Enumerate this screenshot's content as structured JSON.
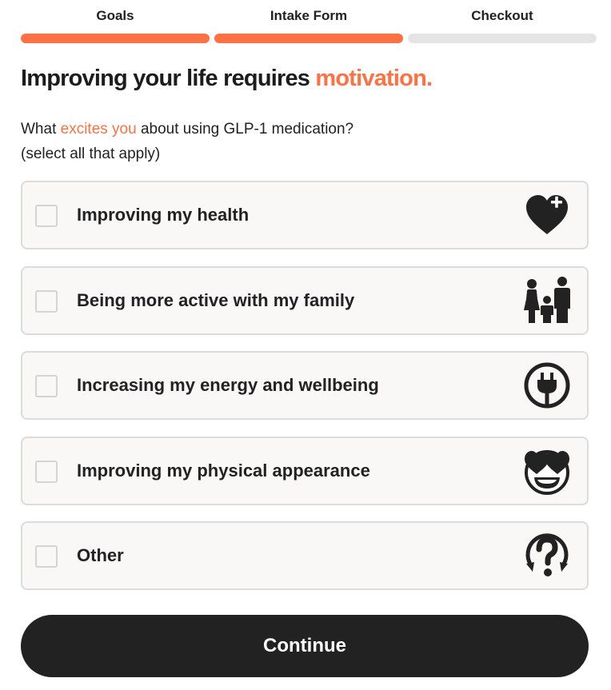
{
  "steps": [
    {
      "label": "Goals",
      "state": "complete"
    },
    {
      "label": "Intake Form",
      "state": "complete"
    },
    {
      "label": "Checkout",
      "state": "incomplete"
    }
  ],
  "headline": {
    "prefix": "Improving your life requires ",
    "accent": "motivation."
  },
  "question": {
    "before": "What ",
    "highlight": "excites you",
    "after": " about using GLP-1 medication?",
    "hint": "(select all that apply)"
  },
  "options": [
    {
      "label": "Improving my health",
      "icon": "heart-plus-icon",
      "checked": false
    },
    {
      "label": "Being more active with my family",
      "icon": "family-icon",
      "checked": false
    },
    {
      "label": "Increasing my energy and wellbeing",
      "icon": "power-plug-icon",
      "checked": false
    },
    {
      "label": "Improving my physical appearance",
      "icon": "heart-eyes-face-icon",
      "checked": false
    },
    {
      "label": "Other",
      "icon": "question-mark-icon",
      "checked": false
    }
  ],
  "continue_label": "Continue",
  "colors": {
    "accent": "#ff7043",
    "dark": "#222222",
    "track": "#e4e4e4",
    "card": "#f9f8f7"
  }
}
